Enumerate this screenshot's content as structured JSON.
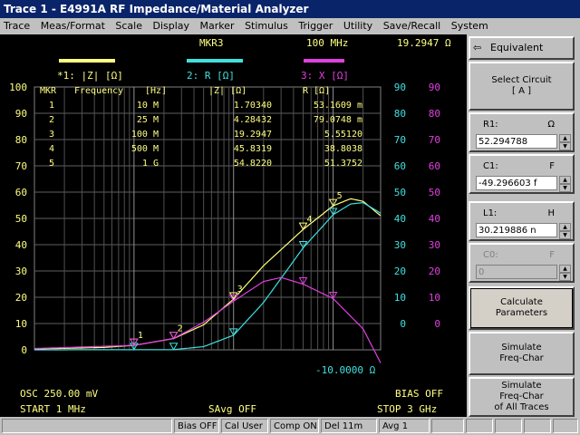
{
  "window": {
    "title": "Trace 1 - E4991A RF Impedance/Material Analyzer"
  },
  "menu": [
    "Trace",
    "Meas/Format",
    "Scale",
    "Display",
    "Marker",
    "Stimulus",
    "Trigger",
    "Utility",
    "Save/Recall",
    "System"
  ],
  "screen": {
    "marker_header": {
      "name": "MKR3",
      "freq": "100 MHz",
      "value": "19.2947 Ω"
    },
    "traces": [
      {
        "label": "*1: |Z| [Ω]",
        "color": "#ffff80"
      },
      {
        "label": "2: R [Ω]",
        "color": "#40e0e0"
      },
      {
        "label": "3: X [Ω]",
        "color": "#e040e0"
      }
    ],
    "marker_table": {
      "headers": [
        "MKR",
        "Frequency",
        "[Hz]",
        "|Z| [Ω]",
        "R [Ω]"
      ],
      "rows": [
        {
          "mkr": "1",
          "freq": "10 M",
          "z": "1.70340",
          "r": "53.1609 m"
        },
        {
          "mkr": "2",
          "freq": "25 M",
          "z": "4.28432",
          "r": "79.0748 m"
        },
        {
          "mkr": "3",
          "freq": "100 M",
          "z": "19.2947",
          "r": "5.55120"
        },
        {
          "mkr": "4",
          "freq": "500 M",
          "z": "45.8319",
          "r": "38.8038"
        },
        {
          "mkr": "5",
          "freq": "1 G",
          "z": "54.8220",
          "r": "51.3752"
        }
      ]
    },
    "left_axis": [
      "100",
      "90",
      "80",
      "70",
      "60",
      "50",
      "40",
      "30",
      "20",
      "10",
      "0"
    ],
    "right_axis_r": [
      "90",
      "80",
      "70",
      "60",
      "50",
      "40",
      "30",
      "20",
      "10",
      "0"
    ],
    "right_axis_x": [
      "90",
      "80",
      "70",
      "60",
      "50",
      "40",
      "30",
      "20",
      "10",
      "0"
    ],
    "ref_value": "-10.0000 Ω",
    "osc": "OSC 250.00 mV",
    "bias": "BIAS OFF",
    "start": "START  1 MHz",
    "savg": "SAvg OFF",
    "stop": "STOP  3 GHz"
  },
  "chart_data": {
    "type": "line",
    "x_scale": "log",
    "xlim_hz": [
      1000000,
      3000000000
    ],
    "series": [
      {
        "name": "*1: |Z| [Ω]",
        "color": "#ffff80",
        "points": [
          [
            1000000.0,
            0.3
          ],
          [
            5000000.0,
            0.9
          ],
          [
            10000000.0,
            1.7
          ],
          [
            25000000.0,
            4.28
          ],
          [
            50000000.0,
            9.5
          ],
          [
            100000000.0,
            19.29
          ],
          [
            200000000.0,
            32
          ],
          [
            500000000.0,
            45.8
          ],
          [
            1000000000.0,
            54.8
          ],
          [
            1500000000.0,
            57.5
          ],
          [
            2000000000.0,
            56.5
          ],
          [
            3000000000.0,
            51
          ]
        ]
      },
      {
        "name": "2: R [Ω]",
        "color": "#40e0e0",
        "points": [
          [
            1000000.0,
            0.0
          ],
          [
            10000000.0,
            0.05
          ],
          [
            25000000.0,
            0.08
          ],
          [
            50000000.0,
            1.2
          ],
          [
            100000000.0,
            5.55
          ],
          [
            200000000.0,
            18
          ],
          [
            500000000.0,
            38.8
          ],
          [
            1000000000.0,
            51.4
          ],
          [
            1500000000.0,
            55.5
          ],
          [
            2000000000.0,
            56
          ],
          [
            3000000000.0,
            52
          ]
        ]
      },
      {
        "name": "3: X [Ω]",
        "color": "#e040e0",
        "points": [
          [
            1000000.0,
            0.5
          ],
          [
            10000000.0,
            1.7
          ],
          [
            25000000.0,
            4.3
          ],
          [
            50000000.0,
            10.5
          ],
          [
            100000000.0,
            18.5
          ],
          [
            200000000.0,
            26
          ],
          [
            300000000.0,
            27.5
          ],
          [
            500000000.0,
            25
          ],
          [
            1000000000.0,
            19.5
          ],
          [
            2000000000.0,
            8
          ],
          [
            3000000000.0,
            -5
          ]
        ]
      }
    ],
    "markers": [
      {
        "id": "1",
        "freq_hz": 10000000
      },
      {
        "id": "2",
        "freq_hz": 25000000
      },
      {
        "id": "3",
        "freq_hz": 100000000
      },
      {
        "id": "4",
        "freq_hz": 500000000
      },
      {
        "id": "5",
        "freq_hz": 1000000000
      }
    ],
    "ylim": [
      0,
      100
    ]
  },
  "softkeys": {
    "header": "Equivalent Circuit:",
    "select_circuit": "Select Circuit\n[ A ]",
    "r1": {
      "label": "R1:",
      "unit": "Ω",
      "value": "52.294788"
    },
    "c1": {
      "label": "C1:",
      "unit": "F",
      "value": "-49.296603 f"
    },
    "l1": {
      "label": "L1:",
      "unit": "H",
      "value": "30.219886 n"
    },
    "c0": {
      "label": "C0:",
      "unit": "F",
      "value": "0"
    },
    "calculate": "Calculate\nParameters",
    "simulate": "Simulate\nFreq-Char",
    "simulate_all": "Simulate\nFreq-Char\nof All Traces"
  },
  "status": [
    "",
    "Bias OFF",
    "Cal User",
    "Comp ON",
    "Del 11m",
    "Avg  1",
    "",
    "",
    "",
    "",
    ""
  ]
}
